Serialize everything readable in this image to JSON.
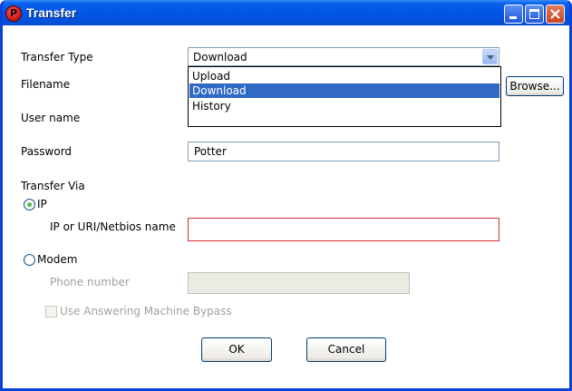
{
  "window": {
    "title": "Transfer",
    "app_icon_letter": "P"
  },
  "form": {
    "transfer_type_label": "Transfer Type",
    "transfer_type_value": "Download",
    "transfer_type_options": [
      "Upload",
      "Download",
      "History"
    ],
    "filename_label": "Filename",
    "browse_label": "Browse...",
    "username_label": "User name",
    "password_label": "Password",
    "password_value": "Potter",
    "transfer_via_label": "Transfer Via",
    "ip_radio_label": "IP",
    "ip_field_label": "IP or URI/Netbios name",
    "ip_value": "",
    "modem_radio_label": "Modem",
    "phone_label": "Phone number",
    "phone_value": "",
    "bypass_label": "Use Answering Machine Bypass"
  },
  "buttons": {
    "ok": "OK",
    "cancel": "Cancel"
  },
  "colors": {
    "title_bar": "#0055e5",
    "selection": "#316ac5",
    "error_border": "#d32f2f",
    "radio_dot": "#21a121"
  }
}
